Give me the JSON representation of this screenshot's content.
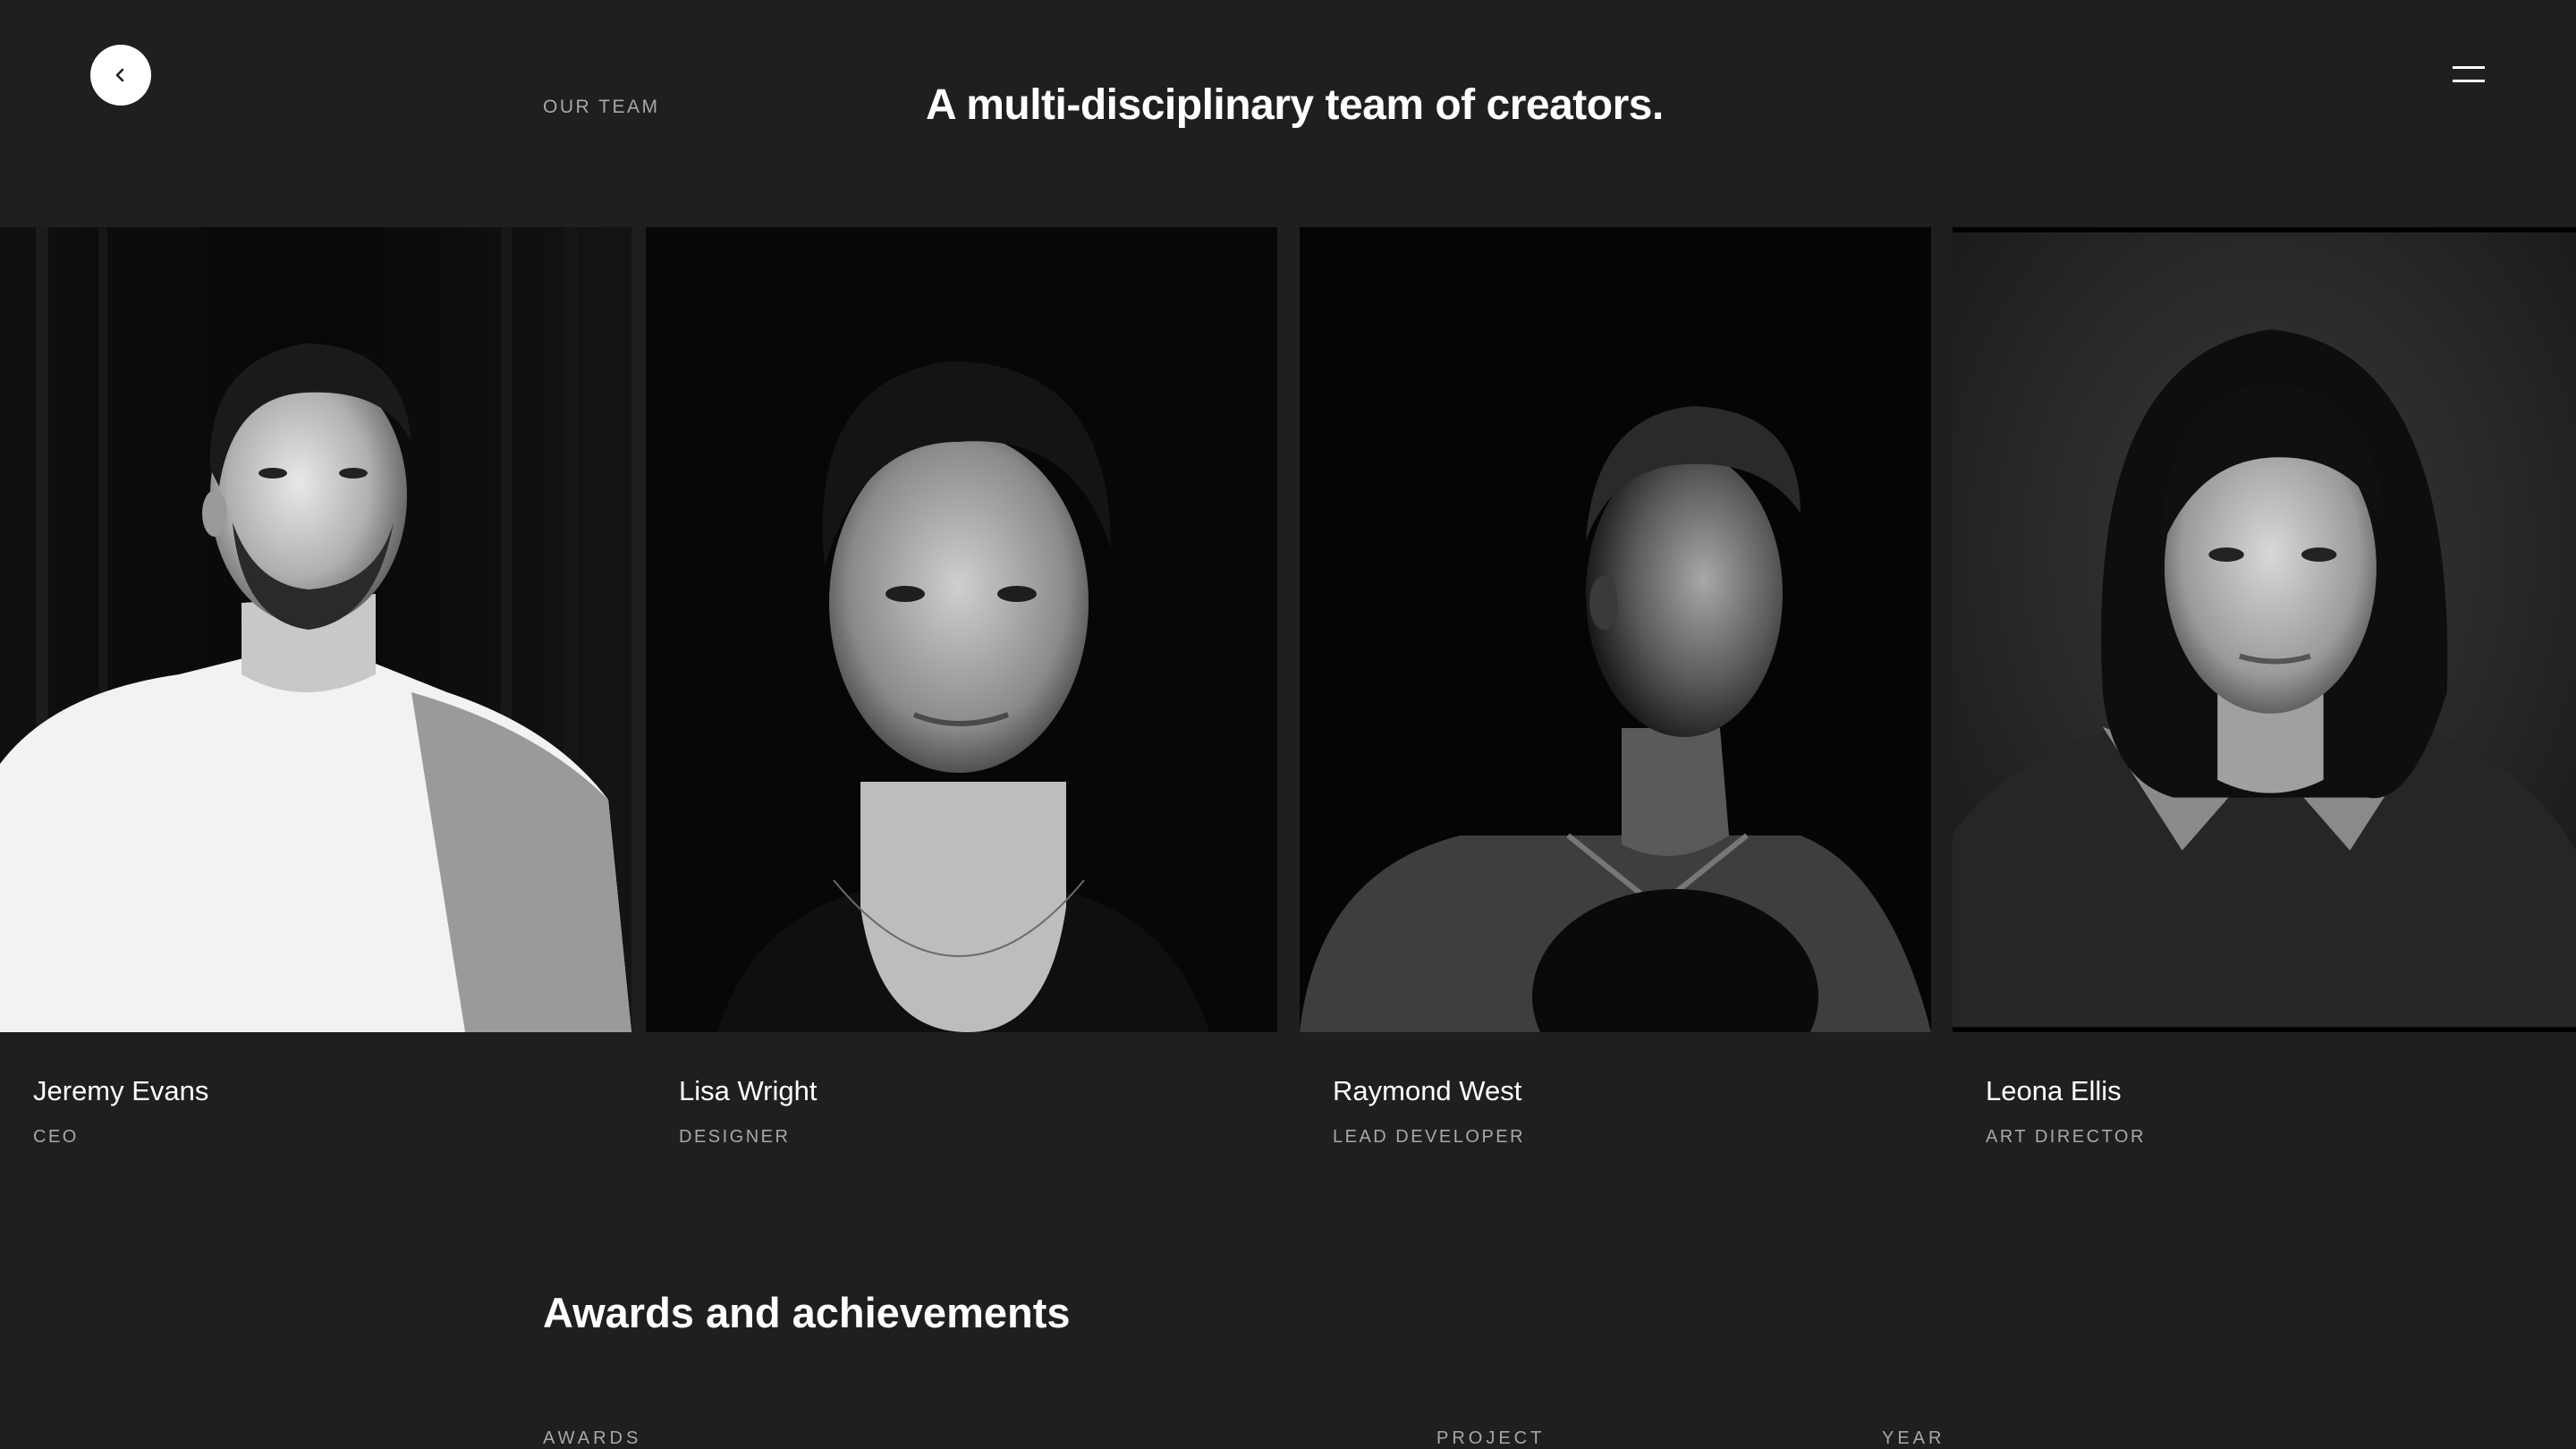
{
  "header": {
    "back_icon": "chevron-left-icon",
    "section_label": "OUR TEAM",
    "title": "A multi-disciplinary team of creators.",
    "menu_icon": "hamburger-menu-icon"
  },
  "team": [
    {
      "name": "Jeremy Evans",
      "role": "CEO"
    },
    {
      "name": "Lisa Wright",
      "role": "DESIGNER"
    },
    {
      "name": "Raymond West",
      "role": "LEAD DEVELOPER"
    },
    {
      "name": "Leona Ellis",
      "role": "ART DIRECTOR"
    }
  ],
  "awards": {
    "title": "Awards and achievements",
    "columns": [
      "AWARDS",
      "PROJECT",
      "YEAR"
    ]
  },
  "colors": {
    "background": "#1f1f1f",
    "text": "#ffffff",
    "muted": "#a8a8a8"
  }
}
